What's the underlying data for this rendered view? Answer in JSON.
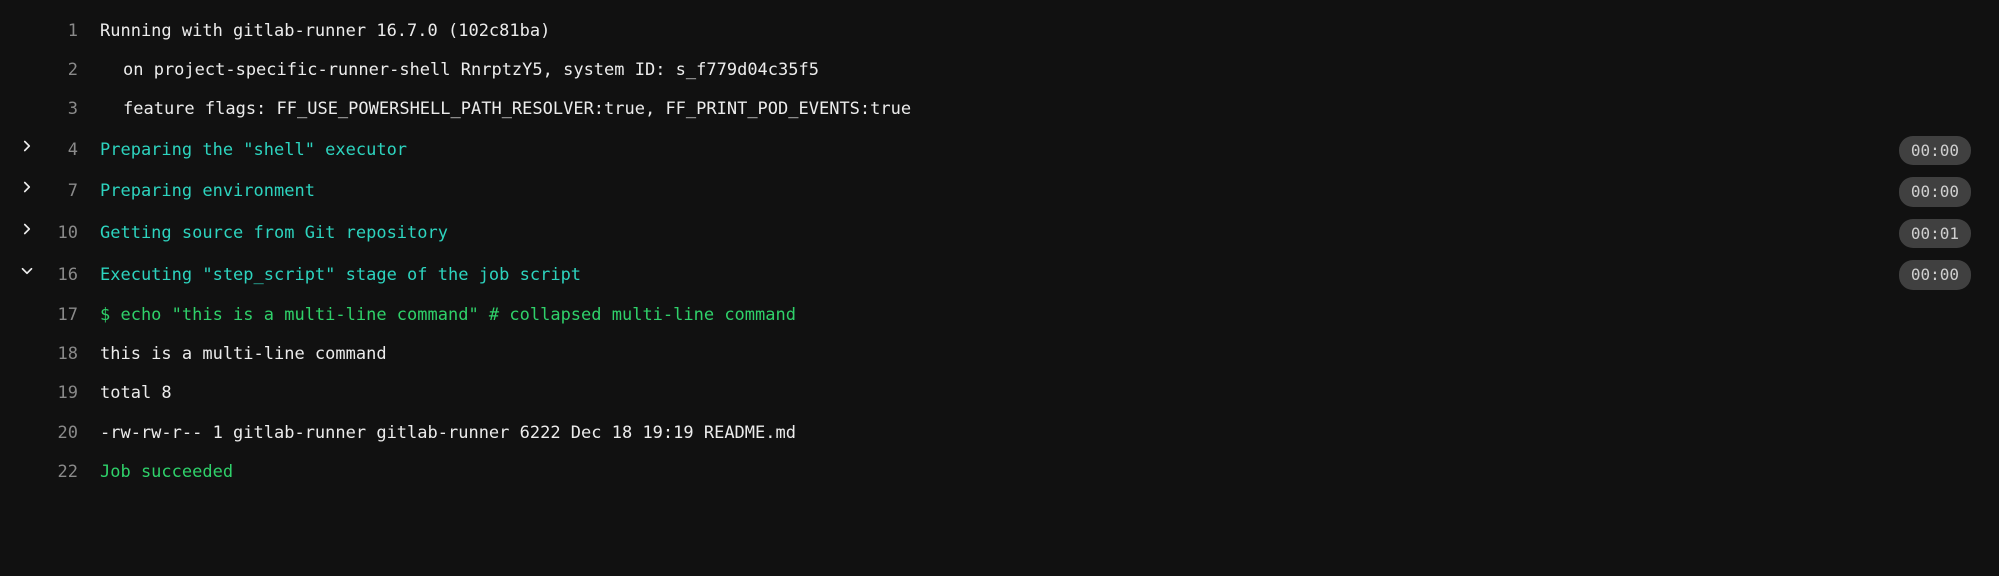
{
  "lines": [
    {
      "n": "1",
      "expand": null,
      "cls": "",
      "indent": false,
      "text": "Running with gitlab-runner 16.7.0 (102c81ba)",
      "dur": null
    },
    {
      "n": "2",
      "expand": null,
      "cls": "",
      "indent": true,
      "text": "on project-specific-runner-shell RnrptzY5, system ID: s_f779d04c35f5",
      "dur": null
    },
    {
      "n": "3",
      "expand": null,
      "cls": "",
      "indent": true,
      "text": "feature flags: FF_USE_POWERSHELL_PATH_RESOLVER:true, FF_PRINT_POD_EVENTS:true",
      "dur": null
    },
    {
      "n": "4",
      "expand": "right",
      "cls": "cyan",
      "indent": false,
      "text": "Preparing the \"shell\" executor",
      "dur": "00:00"
    },
    {
      "n": "7",
      "expand": "right",
      "cls": "cyan",
      "indent": false,
      "text": "Preparing environment",
      "dur": "00:00"
    },
    {
      "n": "10",
      "expand": "right",
      "cls": "cyan",
      "indent": false,
      "text": "Getting source from Git repository",
      "dur": "00:01"
    },
    {
      "n": "16",
      "expand": "down",
      "cls": "cyan",
      "indent": false,
      "text": "Executing \"step_script\" stage of the job script",
      "dur": "00:00"
    },
    {
      "n": "17",
      "expand": null,
      "cls": "green",
      "indent": false,
      "text": "$ echo \"this is a multi-line command\" # collapsed multi-line command",
      "dur": null
    },
    {
      "n": "18",
      "expand": null,
      "cls": "",
      "indent": false,
      "text": "this is a multi-line command",
      "dur": null
    },
    {
      "n": "19",
      "expand": null,
      "cls": "",
      "indent": false,
      "text": "total 8",
      "dur": null
    },
    {
      "n": "20",
      "expand": null,
      "cls": "",
      "indent": false,
      "text": "-rw-rw-r-- 1 gitlab-runner gitlab-runner 6222 Dec 18 19:19 README.md",
      "dur": null
    },
    {
      "n": "22",
      "expand": null,
      "cls": "green",
      "indent": false,
      "text": "Job succeeded",
      "dur": null
    }
  ]
}
